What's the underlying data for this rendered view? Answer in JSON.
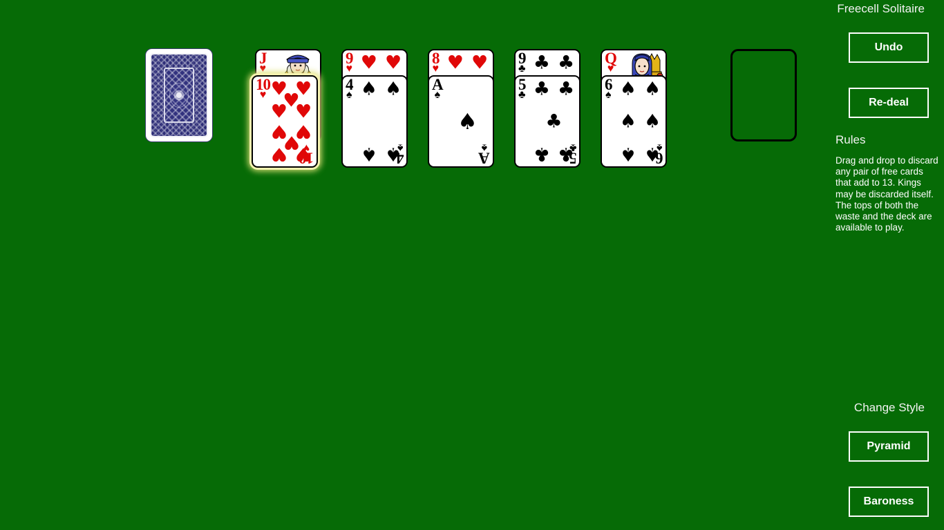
{
  "app": {
    "title": "Freecell Solitaire",
    "background_color": "#066b06"
  },
  "panel": {
    "undo_label": "Undo",
    "redeal_label": "Re-deal",
    "rules_heading": "Rules",
    "rules_text": "Drag and drop to discard any pair of free cards that add to 13. Kings may be discarded itself. The tops of both the waste and the deck are available to play.",
    "change_style_heading": "Change Style",
    "style_pyramid_label": "Pyramid",
    "style_baroness_label": "Baroness"
  },
  "table": {
    "deck": {
      "name": "face-down-deck",
      "face_down": true
    },
    "empty_slot": {
      "name": "waste-slot",
      "empty": true
    },
    "piles": [
      {
        "bottom": {
          "rank": "J",
          "suit": "hearts",
          "suit_glyph": "♥",
          "color": "red",
          "court": true
        },
        "top": {
          "rank": "10",
          "suit": "hearts",
          "suit_glyph": "♥",
          "color": "red",
          "selected": true,
          "pip_count": 10
        }
      },
      {
        "bottom": {
          "rank": "9",
          "suit": "hearts",
          "suit_glyph": "♥",
          "color": "red"
        },
        "top": {
          "rank": "4",
          "suit": "spades",
          "suit_glyph": "♠",
          "color": "black",
          "selected": false,
          "pip_count": 4
        }
      },
      {
        "bottom": {
          "rank": "8",
          "suit": "hearts",
          "suit_glyph": "♥",
          "color": "red"
        },
        "top": {
          "rank": "A",
          "suit": "spades",
          "suit_glyph": "♠",
          "color": "black",
          "selected": false,
          "pip_count": 1
        }
      },
      {
        "bottom": {
          "rank": "9",
          "suit": "clubs",
          "suit_glyph": "♣",
          "color": "black"
        },
        "top": {
          "rank": "5",
          "suit": "clubs",
          "suit_glyph": "♣",
          "color": "black",
          "selected": false,
          "pip_count": 5
        }
      },
      {
        "bottom": {
          "rank": "Q",
          "suit": "hearts",
          "suit_glyph": "♥",
          "color": "red",
          "court": true
        },
        "top": {
          "rank": "6",
          "suit": "spades",
          "suit_glyph": "♠",
          "color": "black",
          "selected": false,
          "pip_count": 6
        }
      }
    ]
  }
}
